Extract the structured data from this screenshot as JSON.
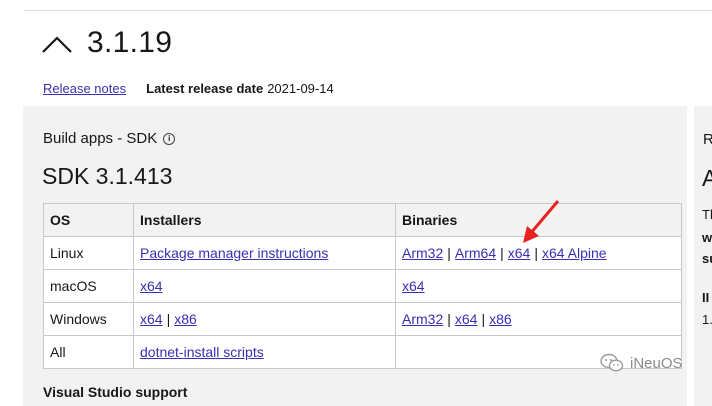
{
  "version": {
    "title": "3.1.19"
  },
  "meta": {
    "release_notes": "Release notes",
    "latest_release_label": "Latest release date",
    "latest_release_date": "2021-09-14"
  },
  "build": {
    "heading": "Build apps - SDK",
    "sdk_title": "SDK 3.1.413",
    "table": {
      "headers": [
        "OS",
        "Installers",
        "Binaries"
      ],
      "rows": [
        {
          "os": "Linux",
          "installers": [
            "Package manager instructions"
          ],
          "binaries": [
            "Arm32",
            "Arm64",
            "x64",
            "x64 Alpine"
          ]
        },
        {
          "os": "macOS",
          "installers": [
            "x64"
          ],
          "binaries": [
            "x64"
          ]
        },
        {
          "os": "Windows",
          "installers": [
            "x64",
            "x86"
          ],
          "binaries": [
            "Arm32",
            "x64",
            "x86"
          ]
        },
        {
          "os": "All",
          "installers": [
            "dotnet-install scripts"
          ],
          "binaries": []
        }
      ],
      "separator": "|"
    }
  },
  "right_partial": {
    "r": "R",
    "a": "A",
    "th": "Th",
    "w": "w",
    "su": "su",
    "ii": "II",
    "one": "1."
  },
  "bottom_partial": "Visual Studio support",
  "watermark": {
    "text": "iNeuOS"
  },
  "colors": {
    "link": "#3b2fb3",
    "arrow": "#e8231f",
    "panel": "#f2f2f2"
  }
}
